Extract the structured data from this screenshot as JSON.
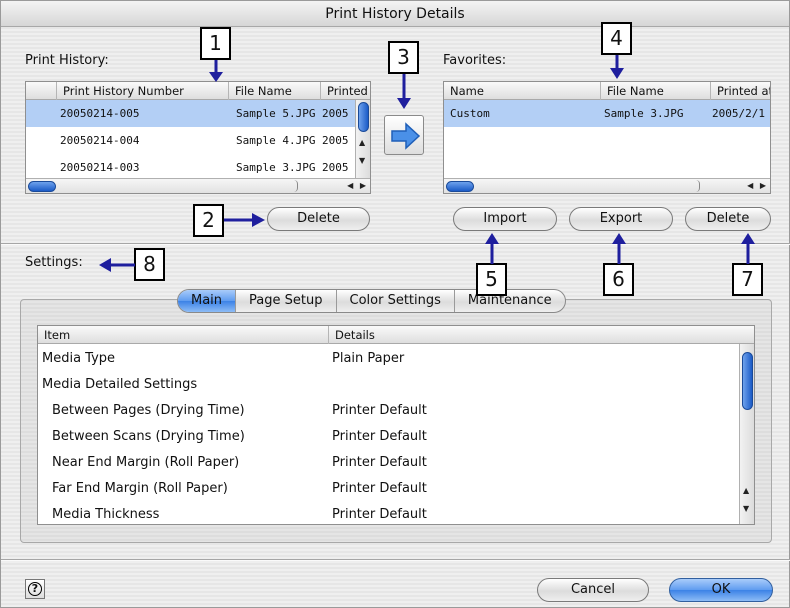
{
  "window": {
    "title": "Print History Details"
  },
  "history": {
    "label": "Print History:",
    "columns": [
      "Print History Number",
      "File Name",
      "Printed"
    ],
    "rows": [
      {
        "number": "20050214-005",
        "file": "Sample 5.JPG",
        "printed": "2005"
      },
      {
        "number": "20050214-004",
        "file": "Sample 4.JPG",
        "printed": "2005"
      },
      {
        "number": "20050214-003",
        "file": "Sample 3.JPG",
        "printed": "2005"
      }
    ],
    "delete_label": "Delete"
  },
  "favorites": {
    "label": "Favorites:",
    "columns": [
      "Name",
      "File Name",
      "Printed at"
    ],
    "rows": [
      {
        "name": "Custom",
        "file": "Sample 3.JPG",
        "printed": "2005/2/1"
      }
    ],
    "import_label": "Import",
    "export_label": "Export",
    "delete_label": "Delete"
  },
  "settings": {
    "label": "Settings:",
    "tabs": [
      "Main",
      "Page Setup",
      "Color Settings",
      "Maintenance"
    ],
    "active_tab": "Main",
    "columns": [
      "Item",
      "Details"
    ],
    "rows": [
      {
        "item": "Media Type",
        "details": "Plain Paper"
      },
      {
        "item": "Media Detailed Settings",
        "details": ""
      },
      {
        "item": "Between Pages (Drying Time)",
        "details": "Printer Default"
      },
      {
        "item": "Between Scans (Drying Time)",
        "details": "Printer Default"
      },
      {
        "item": "Near End Margin (Roll Paper)",
        "details": "Printer Default"
      },
      {
        "item": "Far End Margin (Roll Paper)",
        "details": "Printer Default"
      },
      {
        "item": "Media Thickness",
        "details": "Printer Default"
      }
    ]
  },
  "footer": {
    "cancel_label": "Cancel",
    "ok_label": "OK",
    "help_icon": "question-icon"
  },
  "callouts": [
    "1",
    "2",
    "3",
    "4",
    "5",
    "6",
    "7",
    "8"
  ],
  "colors": {
    "selection": "#b3cff5",
    "accent": "#3c82e6",
    "callout_arrow": "#1f1f9e"
  }
}
